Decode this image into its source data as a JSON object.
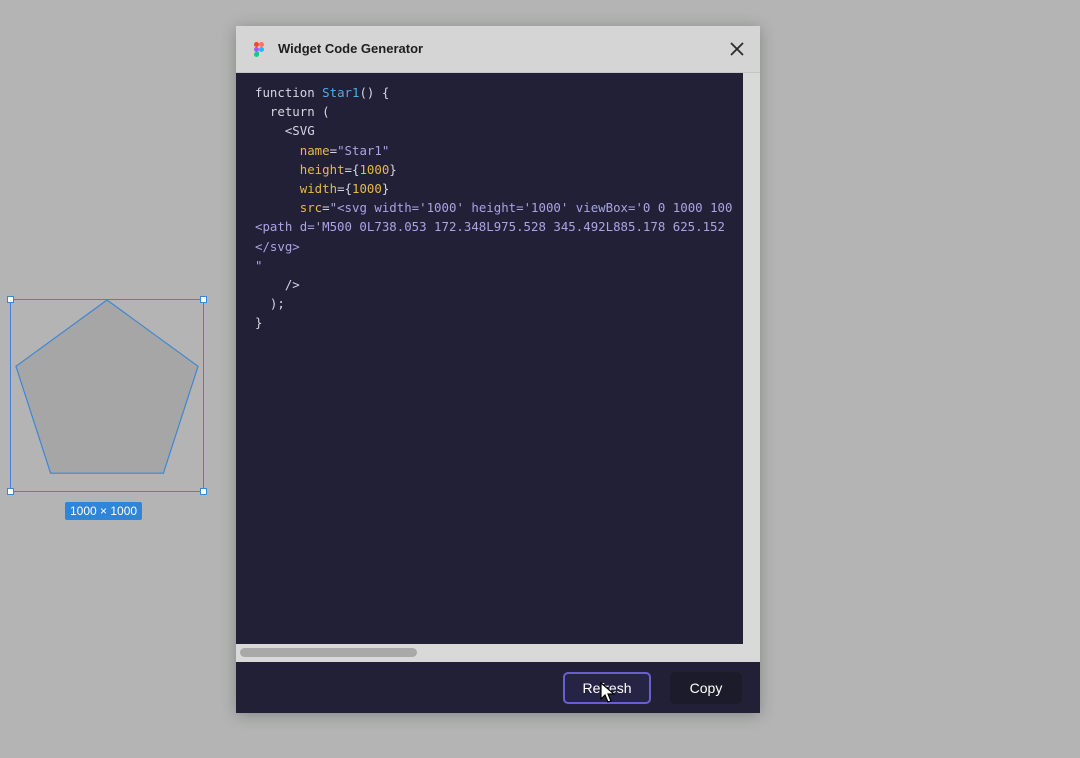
{
  "canvas": {
    "size_badge": "1000 × 1000",
    "shape_icon": "pentagon-shape",
    "shape_fill": "#a6a6a6",
    "selection_color": "#3d86d6"
  },
  "window": {
    "title": "Widget Code Generator",
    "logo_icon": "figma-logo-icon",
    "close_icon": "close-icon"
  },
  "code": {
    "lines": [
      "function Star1() {",
      "  return (",
      "    <SVG",
      "      name=\"Star1\"",
      "      height={1000}",
      "      width={1000}",
      "      src=\"<svg width='1000' height='1000' viewBox='0 0 1000 100",
      "<path d='M500 0L738.053 172.348L975.528 345.492L885.178 625.152",
      "</svg>",
      "\"",
      "    />",
      "  );",
      "}"
    ]
  },
  "footer": {
    "refresh_label": "Refresh",
    "copy_label": "Copy"
  },
  "colors": {
    "canvas_bg": "#b3b4b3",
    "editor_bg": "#222036",
    "accent": "#6a5fd0"
  }
}
